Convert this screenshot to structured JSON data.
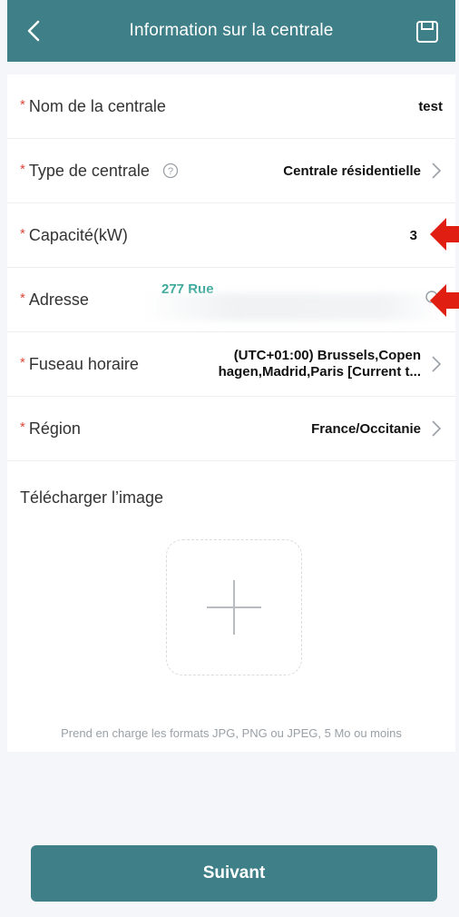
{
  "header": {
    "title": "Information sur la centrale"
  },
  "fields": [
    {
      "label": "Nom de la centrale",
      "value": "test"
    },
    {
      "label": "Type de centrale",
      "value": "Centrale résidentielle"
    },
    {
      "label": "Capacité(kW)",
      "value": "3"
    },
    {
      "label": "Adresse",
      "value": "277 Rue"
    },
    {
      "label": "Fuseau horaire",
      "value_line1": "(UTC+01:00) Brussels,Copen",
      "value_line2": "hagen,Madrid,Paris [Current t..."
    },
    {
      "label": "Région",
      "value": "France/Occitanie"
    }
  ],
  "required_mark": "*",
  "upload": {
    "label": "Télécharger l’image",
    "note": "Prend en charge les formats JPG, PNG ou JPEG, 5 Mo ou moins"
  },
  "footer": {
    "next_label": "Suivant"
  },
  "colors": {
    "accent": "#3f7f88",
    "required": "#e0473a",
    "address_text": "#3aa89a",
    "annotation_arrow": "#e01e12"
  },
  "icons": [
    "back-arrow-icon",
    "save-icon",
    "help-icon",
    "chevron-right-icon",
    "location-icon",
    "plus-icon",
    "red-arrow-icon"
  ]
}
